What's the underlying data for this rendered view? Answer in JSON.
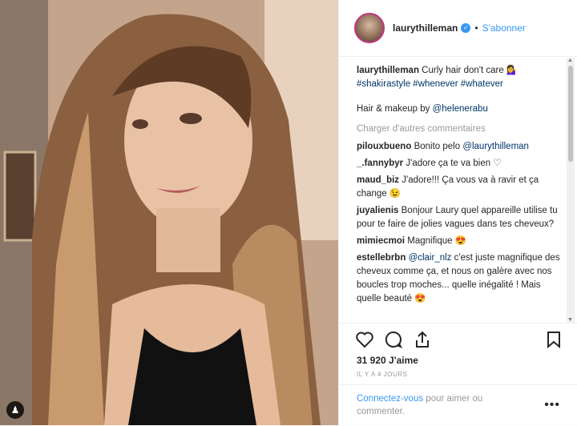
{
  "header": {
    "username": "laurythilleman",
    "follow_label": "S'abonner",
    "separator": "•"
  },
  "caption": {
    "username": "laurythilleman",
    "text": "Curly hair don't care 💁‍♀️",
    "hashtags": "#shakirastyle #whenever #whatever",
    "credit_prefix": "Hair & makeup by ",
    "credit_mention": "@helenerabu"
  },
  "load_more": "Charger d'autres commentaires",
  "comments": [
    {
      "user": "pilouxbueno",
      "text": "Bonito pelo ",
      "mention": "@laurythilleman"
    },
    {
      "user": "_.fannybyr",
      "text": "J'adore ça te va bien ♡",
      "mention": ""
    },
    {
      "user": "maud_biz",
      "text": "J'adore!!! Ça vous va à ravir et ça change 😉",
      "mention": ""
    },
    {
      "user": "juyalienis",
      "text": "Bonjour Laury quel appareille utilise tu pour te faire de jolies vagues dans tes cheveux?",
      "mention": ""
    },
    {
      "user": "mimiecmoi",
      "text": "Magnifique 😍",
      "mention": ""
    },
    {
      "user": "estellebrbn",
      "text": " c'est juste magnifique des cheveux comme ça, et nous on galère avec nos boucles trop moches... quelle inégalité ! Mais quelle beauté 😍",
      "mention": "@clair_nlz"
    }
  ],
  "likes": "31 920 J'aime",
  "time": "IL Y A 4 JOURS",
  "footer": {
    "login_link": "Connectez-vous",
    "rest": " pour aimer ou commenter.",
    "options": "•••"
  },
  "icons": [
    "heart-icon",
    "comment-icon",
    "share-icon",
    "bookmark-icon",
    "user-tag-icon",
    "verified-icon"
  ],
  "colors": {
    "link": "#3897f0",
    "mention": "#003569",
    "muted": "#999999"
  }
}
